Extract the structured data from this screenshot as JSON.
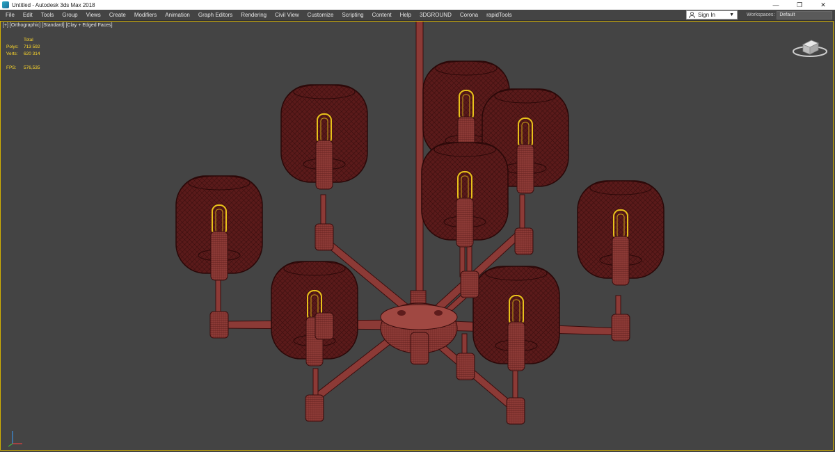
{
  "window": {
    "title": "Untitled - Autodesk 3ds Max 2018"
  },
  "window_controls": {
    "minimize": "—",
    "restore": "❐",
    "close": "✕"
  },
  "menu": {
    "items": [
      "File",
      "Edit",
      "Tools",
      "Group",
      "Views",
      "Create",
      "Modifiers",
      "Animation",
      "Graph Editors",
      "Rendering",
      "Civil View",
      "Customize",
      "Scripting",
      "Content",
      "Help",
      "3DGROUND",
      "Corona",
      "rapidTools"
    ]
  },
  "account": {
    "sign_in": "Sign In"
  },
  "workspaces": {
    "label": "Workspaces:",
    "value": "Default"
  },
  "viewport": {
    "label": "[+] [Orthographic] [Standard] [Clay + Edged Faces]",
    "stats": {
      "header": "Total",
      "polys_label": "Polys:",
      "polys": "713 592",
      "verts_label": "Verts:",
      "verts": "620 314",
      "fps_label": "FPS:",
      "fps": "576,535"
    }
  },
  "colors": {
    "viewport_bg": "#444444",
    "mesh": "#6b1e1e",
    "wire": "#3a0e0e",
    "bulb": "#e8c21a",
    "active_border": "#d4b200"
  },
  "icons": {
    "app": "3dsmax-icon",
    "user": "user-icon",
    "viewcube": "viewcube-icon",
    "axis": "axis-tripod-icon"
  }
}
